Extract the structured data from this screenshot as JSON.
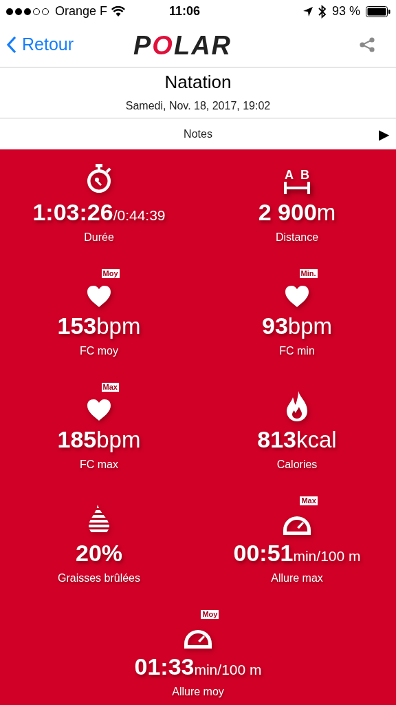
{
  "status_bar": {
    "carrier": "Orange F",
    "time": "11:06",
    "battery": "93 %"
  },
  "nav": {
    "back": "Retour",
    "logo": "POLAR"
  },
  "header": {
    "title": "Natation",
    "date": "Samedi, Nov. 18, 2017, 19:02"
  },
  "notes": {
    "label": "Notes",
    "arrow": "▶"
  },
  "metrics": [
    {
      "kind": "stopwatch",
      "value": "1:03:26",
      "unit": "/0:44:39",
      "label": "Durée"
    },
    {
      "kind": "distance",
      "markers": [
        "A",
        "B"
      ],
      "value": "2 900",
      "unit": "m",
      "label": "Distance"
    },
    {
      "kind": "heart",
      "badge": "Moy",
      "value": "153",
      "unit": "bpm",
      "label": "FC moy"
    },
    {
      "kind": "heart",
      "badge": "Min.",
      "value": "93",
      "unit": "bpm",
      "label": "FC min"
    },
    {
      "kind": "heart",
      "badge": "Max",
      "value": "185",
      "unit": "bpm",
      "label": "FC max"
    },
    {
      "kind": "flame",
      "value": "813",
      "unit": "kcal",
      "label": "Calories"
    },
    {
      "kind": "fat",
      "value": "20%",
      "label": "Graisses brûlées"
    },
    {
      "kind": "gauge",
      "badge": "Max",
      "value": "00:51",
      "unit": "min/100 m",
      "label": "Allure max"
    },
    {
      "kind": "gauge",
      "badge": "Moy",
      "value": "01:33",
      "unit": "min/100 m",
      "label": "Allure moy"
    }
  ]
}
